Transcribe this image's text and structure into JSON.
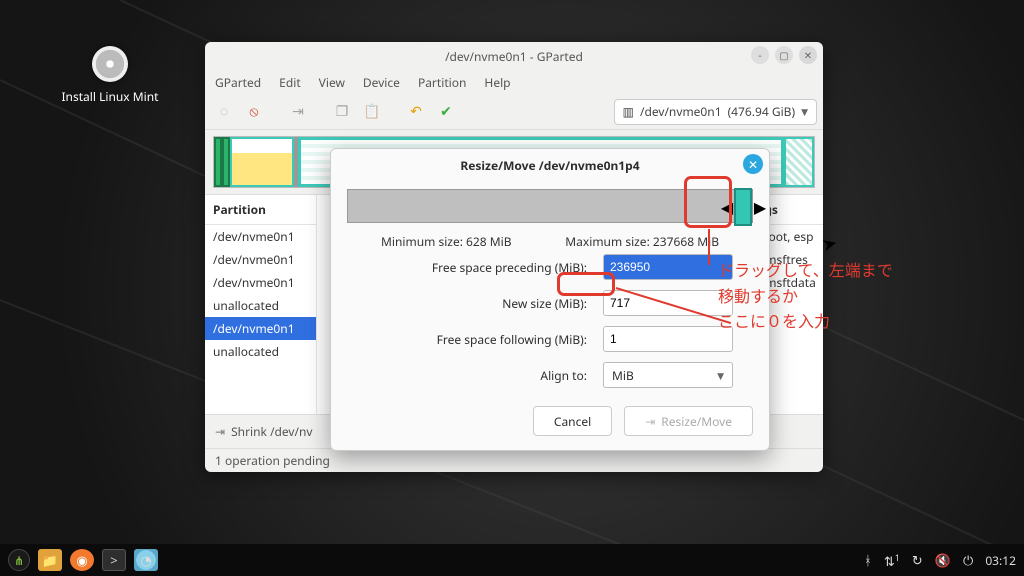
{
  "desktop": {
    "install_label": "Install Linux Mint"
  },
  "window": {
    "title": "/dev/nvme0n1 - GParted",
    "menu": [
      "GParted",
      "Edit",
      "View",
      "Device",
      "Partition",
      "Help"
    ],
    "device_name": "/dev/nvme0n1",
    "device_size": "(476.94 GiB)",
    "columns": {
      "partition": "Partition",
      "flags": "Flags"
    },
    "partitions": [
      {
        "name": "/dev/nvme0n1",
        "flags": "boot, esp",
        "size_hint": "B"
      },
      {
        "name": "/dev/nvme0n1",
        "flags": "msftres",
        "size_hint": "—"
      },
      {
        "name": "/dev/nvme0n1",
        "flags": "msftdata",
        "size_hint": "—"
      },
      {
        "name": "unallocated",
        "flags": ""
      },
      {
        "name": "/dev/nvme0n1",
        "flags": "",
        "selected": true
      },
      {
        "name": "unallocated",
        "flags": ""
      }
    ],
    "flag_suffix": "B",
    "pending_op": "Shrink /dev/nv",
    "status": "1 operation pending"
  },
  "dialog": {
    "title": "Resize/Move /dev/nvme0n1p4",
    "minimum": "Minimum size: 628 MiB",
    "maximum": "Maximum size: 237668 MiB",
    "labels": {
      "preceding": "Free space preceding (MiB):",
      "newsize": "New size (MiB):",
      "following": "Free space following (MiB):",
      "align": "Align to:"
    },
    "values": {
      "preceding": "236950",
      "newsize": "717",
      "following": "1",
      "align": "MiB"
    },
    "buttons": {
      "cancel": "Cancel",
      "apply": "Resize/Move"
    }
  },
  "annotation": {
    "line1": "ドラッグして、左端まで",
    "line2": "移動するか",
    "line3": "ここに０を入力"
  },
  "taskbar": {
    "clock": "03:12",
    "net": "1"
  }
}
